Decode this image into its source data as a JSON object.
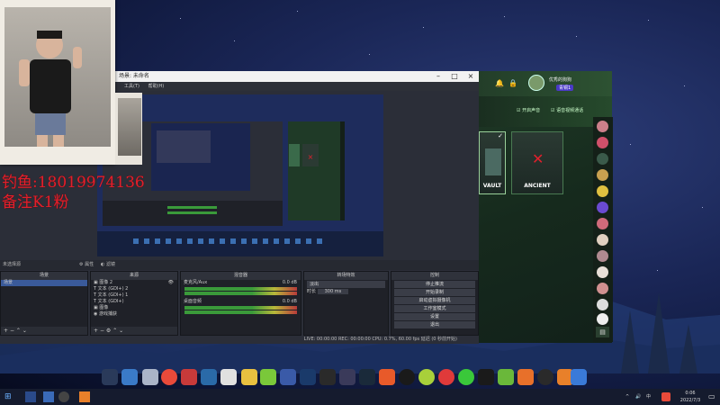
{
  "overlay": {
    "line1": "钓鱼:18019974136",
    "line2": "备注K1粉"
  },
  "obs": {
    "title": "场景: 未命名",
    "menu": [
      "工具(T)",
      "帮助(H)"
    ],
    "scene_label": "未选择源",
    "tb_btn1": "属性",
    "tb_btn2": "滤镜",
    "docks": {
      "scenes": "场景",
      "sources": "来源",
      "mixer": "混音器",
      "transitions": "转场特效",
      "controls": "控制"
    },
    "scenes": [
      "场景"
    ],
    "sources": [
      "图像 2",
      "文本 (GDI+) 2",
      "文本 (GDI+) 1",
      "文本 (GDI+)",
      "图像",
      "游戏捕获"
    ],
    "mixer": [
      {
        "name": "麦克风/Aux",
        "db": "0.0 dB",
        "level": 0.55
      },
      {
        "name": "桌面音频",
        "db": "0.0 dB",
        "level": 0.5
      }
    ],
    "transition": {
      "type": "淡出",
      "duration_label": "时长",
      "duration": "300 ms"
    },
    "controls": [
      "停止推流",
      "开始录制",
      "启动虚拟摄像机",
      "工作室模式",
      "设置",
      "退出"
    ],
    "status": "LIVE: 00:00:00   REC: 00:00:00   CPU: 0.7%, 60.00 fps   延迟 (0 秒前开始)"
  },
  "game": {
    "username": "优秀的狗狗",
    "badge": "青铜1",
    "opts": [
      "开启声音",
      "语音视频通话"
    ],
    "maps": [
      {
        "name": "VAULT",
        "banned": false
      },
      {
        "name": "ANCIENT",
        "banned": true
      }
    ]
  },
  "taskbar": {
    "time": "0:06",
    "date": "2022/7/3",
    "lang": "中",
    "tray_icon": "speaker-icon"
  },
  "colors": {
    "accent_red": "#e0202c",
    "green": "#3a9a3a"
  }
}
